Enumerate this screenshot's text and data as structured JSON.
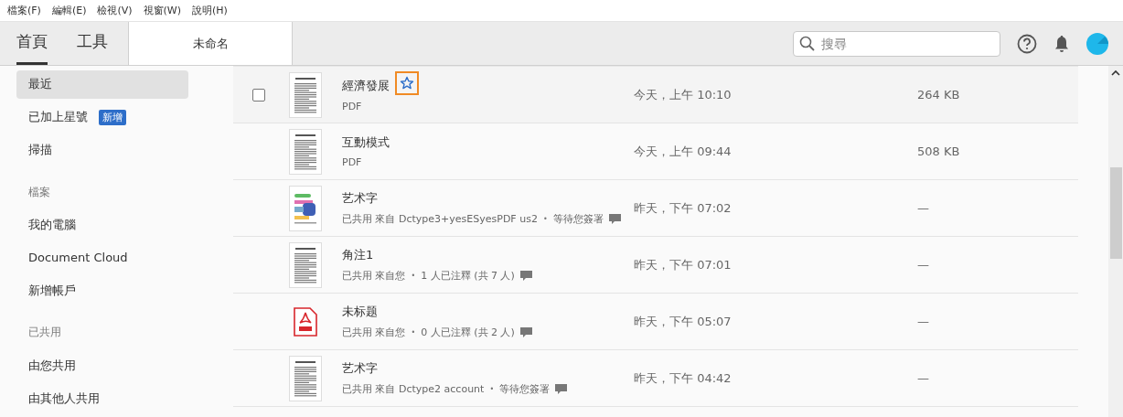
{
  "menu": [
    "檔案(F)",
    "編輯(E)",
    "檢視(V)",
    "視窗(W)",
    "說明(H)"
  ],
  "tabs": [
    {
      "label": "首頁",
      "selected": true
    },
    {
      "label": "工具",
      "selected": false
    }
  ],
  "document_tab": "未命名",
  "search": {
    "placeholder": "搜尋"
  },
  "sidebar": [
    {
      "kind": "item",
      "label": "最近",
      "selected": true
    },
    {
      "kind": "item",
      "label": "已加上星號",
      "selected": false,
      "badge": "新增"
    },
    {
      "kind": "item",
      "label": "掃描",
      "selected": false
    },
    {
      "kind": "header",
      "label": "檔案"
    },
    {
      "kind": "item",
      "label": "我的電腦",
      "selected": false
    },
    {
      "kind": "item",
      "label": "Document Cloud",
      "selected": false
    },
    {
      "kind": "item",
      "label": "新增帳戶",
      "selected": false
    },
    {
      "kind": "header",
      "label": "已共用"
    },
    {
      "kind": "item",
      "label": "由您共用",
      "selected": false
    },
    {
      "kind": "item",
      "label": "由其他人共用",
      "selected": false
    }
  ],
  "files": [
    {
      "name": "經濟發展",
      "kind": "doc",
      "selected": true,
      "checked": false,
      "starred": false,
      "type": "PDF",
      "modified": "今天，上午 10:10",
      "size": "264 KB"
    },
    {
      "name": "互動模式",
      "kind": "doc",
      "selected": false,
      "type": "PDF",
      "modified": "今天，上午 09:44",
      "size": "508 KB"
    },
    {
      "name": "艺术字",
      "kind": "colorful",
      "selected": false,
      "shared": "已共用 來自 Dctype3+yesESyesPDF us2",
      "bullet": "•",
      "status": "等待您簽署",
      "modified": "昨天，下午 07:02",
      "size": "—"
    },
    {
      "name": "角注1",
      "kind": "doc",
      "selected": false,
      "shared": "已共用 來自您",
      "bullet": "•",
      "status": "1 人已注釋 (共 7 人)",
      "modified": "昨天，下午 07:01",
      "size": "—"
    },
    {
      "name": "未标题",
      "kind": "pdf",
      "selected": false,
      "shared": "已共用 來自您",
      "bullet": "•",
      "status": "0 人已注釋 (共 2 人)",
      "modified": "昨天，下午 05:07",
      "size": "—"
    },
    {
      "name": "艺术字",
      "kind": "doc",
      "selected": false,
      "shared": "已共用 來自 Dctype2 account",
      "bullet": "•",
      "status": "等待您簽署",
      "modified": "昨天，下午 04:42",
      "size": "—"
    }
  ]
}
